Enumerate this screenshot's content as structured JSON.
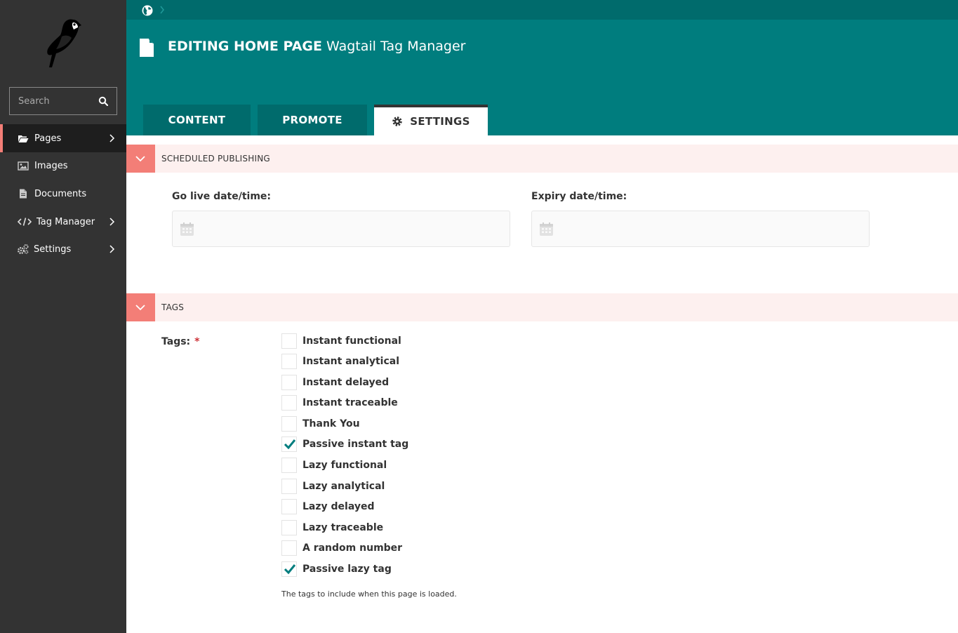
{
  "sidebar": {
    "search_placeholder": "Search",
    "items": [
      {
        "label": "Pages",
        "icon": "folder-open-icon",
        "active": true,
        "has_children": true
      },
      {
        "label": "Images",
        "icon": "image-icon",
        "active": false,
        "has_children": false
      },
      {
        "label": "Documents",
        "icon": "document-icon",
        "active": false,
        "has_children": false
      },
      {
        "label": "Tag Manager",
        "icon": "code-icon",
        "active": false,
        "has_children": true
      },
      {
        "label": "Settings",
        "icon": "cogs-icon",
        "active": false,
        "has_children": true
      }
    ]
  },
  "header": {
    "title_prefix": "EDITING HOME PAGE",
    "title_name": "Wagtail Tag Manager",
    "tabs": [
      {
        "label": "CONTENT",
        "active": false
      },
      {
        "label": "PROMOTE",
        "active": false
      },
      {
        "label": "SETTINGS",
        "active": true
      }
    ]
  },
  "scheduled": {
    "title": "SCHEDULED PUBLISHING",
    "go_live_label": "Go live date/time:",
    "go_live_value": "",
    "expiry_label": "Expiry date/time:",
    "expiry_value": ""
  },
  "tags_panel": {
    "title": "TAGS",
    "field_label": "Tags:",
    "required_mark": "*",
    "options": [
      {
        "label": "Instant functional",
        "checked": false
      },
      {
        "label": "Instant analytical",
        "checked": false
      },
      {
        "label": "Instant delayed",
        "checked": false
      },
      {
        "label": "Instant traceable",
        "checked": false
      },
      {
        "label": "Thank You",
        "checked": false
      },
      {
        "label": "Passive instant tag",
        "checked": true
      },
      {
        "label": "Lazy functional",
        "checked": false
      },
      {
        "label": "Lazy analytical",
        "checked": false
      },
      {
        "label": "Lazy delayed",
        "checked": false
      },
      {
        "label": "Lazy traceable",
        "checked": false
      },
      {
        "label": "A random number",
        "checked": false
      },
      {
        "label": "Passive lazy tag",
        "checked": true
      }
    ],
    "help_text": "The tags to include when this page is loaded."
  },
  "colors": {
    "sidebar": "#333333",
    "header": "#007d7e",
    "accent": "#f37e77",
    "check": "#007d7e"
  }
}
